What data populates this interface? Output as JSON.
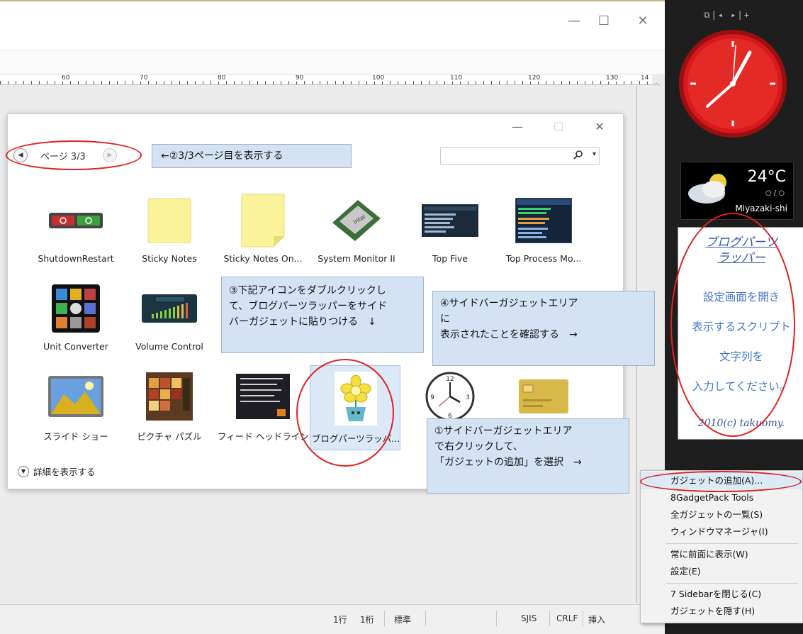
{
  "editor": {
    "window_controls": {
      "minimize": "—",
      "maximize": "☐",
      "close": "✕"
    },
    "ruler_labels": [
      "60",
      "70",
      "80",
      "90",
      "100",
      "110",
      "120",
      "130",
      "14"
    ],
    "status": {
      "line": "1行",
      "col": "1桁",
      "mode": "標準",
      "encoding": "SJIS",
      "eol": "CRLF",
      "insert": "挿入"
    }
  },
  "gallery": {
    "window_controls": {
      "minimize": "—",
      "maximize": "☐",
      "close": "✕"
    },
    "pager": {
      "prev": "◀",
      "next": "▶",
      "label": "ページ 3/3"
    },
    "search": {
      "value": "",
      "dropdown": "▾"
    },
    "items": [
      {
        "label": "ShutdownRestart",
        "icon": "shutdown-restart-icon"
      },
      {
        "label": "Sticky Notes",
        "icon": "sticky-note-icon"
      },
      {
        "label": "Sticky Notes On...",
        "icon": "sticky-note-icon"
      },
      {
        "label": "System Monitor II",
        "icon": "cpu-chip-icon"
      },
      {
        "label": "Top Five",
        "icon": "process-list-icon"
      },
      {
        "label": "Top Process Mo...",
        "icon": "process-monitor-icon"
      },
      {
        "label": "Unit Converter",
        "icon": "unit-converter-icon"
      },
      {
        "label": "Volume Control",
        "icon": "volume-meter-icon"
      },
      {
        "label": "スライド ショー",
        "icon": "slideshow-icon"
      },
      {
        "label": "ピクチャ パズル",
        "icon": "picture-puzzle-icon"
      },
      {
        "label": "フィード ヘッドライン",
        "icon": "feed-headlines-icon"
      },
      {
        "label": "ブログパーツラッパ...",
        "icon": "flower-character-icon"
      },
      {
        "label": "",
        "icon": "analog-clock-icon"
      },
      {
        "label": "",
        "icon": "gold-card-icon"
      }
    ],
    "details_label": "詳細を表示する",
    "details_icon": "chevron-down-icon"
  },
  "callouts": {
    "step1": [
      "①サイドバーガジェットエリア",
      "で右クリックして、",
      "「ガジェットの追加」を選択　→"
    ],
    "step2": "←②3/3ページ目を表示する",
    "step3": [
      "③下記アイコンをダブルクリックし",
      "て、ブログパーツラッパーをサイド",
      "バーガジェットに貼りつける　↓"
    ],
    "step4": [
      "④サイドバーガジェットエリア",
      "に",
      "表示されたことを確認する　→"
    ]
  },
  "sidebar": {
    "toolbar": "⧉|◂ ▸|+",
    "weather": {
      "temp": "24°C",
      "range": "○ / ○",
      "city": "Miyazaki-shi"
    },
    "blog_gadget": {
      "title_line1": "ブログパーツ",
      "title_line2": "ラッパー",
      "lines": [
        "設定画面を開き",
        "表示するスクリプト",
        "文字列を",
        "入力してください。"
      ],
      "footer": "2010(c) takuomy."
    }
  },
  "context_menu": {
    "items": [
      {
        "label": "ガジェットの追加(A)...",
        "highlighted": true
      },
      {
        "label": "8GadgetPack Tools"
      },
      {
        "label": "全ガジェットの一覧(S)"
      },
      {
        "label": "ウィンドウマネージャ(I)"
      },
      {
        "label": "常に前面に表示(W)"
      },
      {
        "label": "設定(E)"
      },
      {
        "label": "7 Sidebarを閉じる(C)"
      },
      {
        "label": "ガジェットを隠す(H)"
      }
    ]
  },
  "colors": {
    "accent_red": "#e02020",
    "callout_bg": "#d4e2f4",
    "clock_red": "#d01818",
    "menu_highlight": "#dce9f7"
  }
}
